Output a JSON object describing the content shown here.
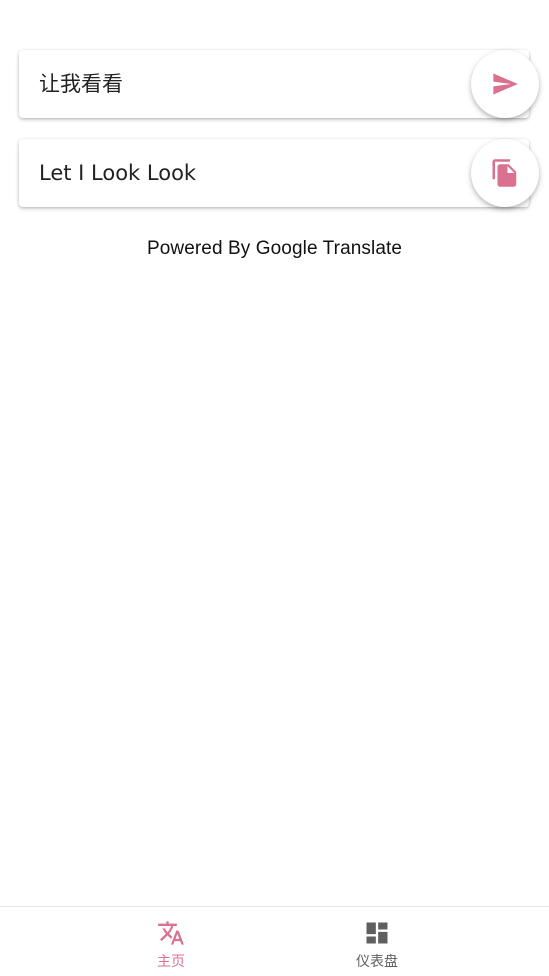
{
  "colors": {
    "accent": "#d9718f",
    "inactive": "#5f5f5f",
    "text": "#222222"
  },
  "input": {
    "value": "让我看看",
    "send_icon": "send-icon"
  },
  "output": {
    "text": "Let I Look Look",
    "copy_icon": "copy-icon"
  },
  "footer": {
    "powered_by": "Powered By Google Translate"
  },
  "bottom_nav": {
    "items": [
      {
        "label": "主页",
        "icon": "translate-icon",
        "active": true
      },
      {
        "label": "仪表盘",
        "icon": "dashboard-icon",
        "active": false
      }
    ]
  }
}
